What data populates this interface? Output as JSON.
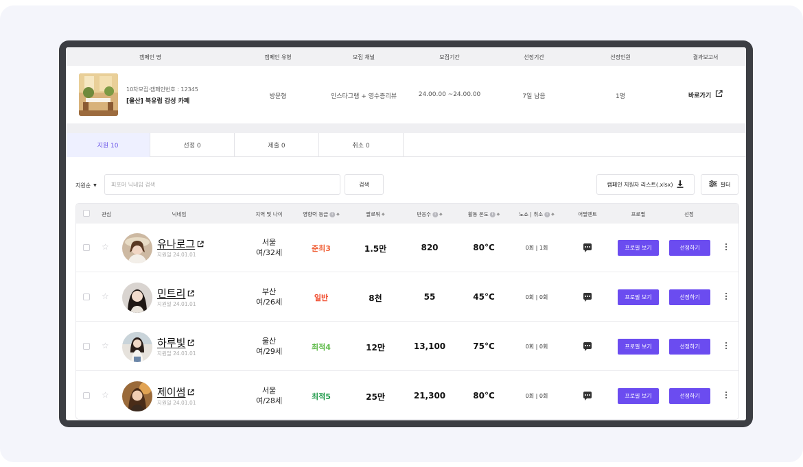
{
  "campaign": {
    "headers": [
      "캠페인 명",
      "캠페인 유형",
      "모집 채널",
      "모집기간",
      "선정기간",
      "선정인원",
      "결과보고서"
    ],
    "subtitle": "10차모집·캠페인번호 : 12345",
    "title": "[울산] 북유럽 감성 카페",
    "type": "방문형",
    "channel": "인스타그램 + 영수증리뷰",
    "recruit_period": "24.00.00 ~24.00.00",
    "select_period": "7일 남음",
    "select_count": "1명",
    "report_link": "바로가기"
  },
  "tabs": [
    {
      "label": "지원 10",
      "active": true
    },
    {
      "label": "선정 0",
      "active": false
    },
    {
      "label": "제출 0",
      "active": false
    },
    {
      "label": "취소 0",
      "active": false
    }
  ],
  "toolbar": {
    "sort_label": "지원순",
    "search_placeholder": "피포머 닉네임 검색",
    "search_button": "검색",
    "excel_button": "캠페인 지원자 리스트(.xlsx)",
    "filter_button": "필터"
  },
  "table": {
    "headers": {
      "fav": "관심",
      "nickname": "닉네임",
      "region_age": "지역 및 나이",
      "grade": "영향력 등급",
      "followers": "팔로워",
      "responses": "반응수",
      "temperature": "활동 온도",
      "exposure": "노쇼 | 취소",
      "comment": "어필멘트",
      "profile": "프로필",
      "select": "선정"
    },
    "profile_button": "프로필 보기",
    "select_button": "선정하기",
    "rows": [
      {
        "nickname": "유나로그",
        "applied": "지원일 24.01.01",
        "region": "서울",
        "age": "여/32세",
        "grade": "준최3",
        "grade_color": "#f0643c",
        "followers": "1.5만",
        "responses": "820",
        "temperature": "80°C",
        "noshow": "0회 | 1회"
      },
      {
        "nickname": "민트리",
        "applied": "지원일 24.01.01",
        "region": "부산",
        "age": "여/26세",
        "grade": "일반",
        "grade_color": "#f04b2d",
        "followers": "8천",
        "responses": "55",
        "temperature": "45°C",
        "noshow": "0회 | 0회"
      },
      {
        "nickname": "하루빛",
        "applied": "지원일 24.01.01",
        "region": "울산",
        "age": "여/29세",
        "grade": "최적4",
        "grade_color": "#5fbb4a",
        "followers": "12만",
        "responses": "13,100",
        "temperature": "75°C",
        "noshow": "0회 | 0회"
      },
      {
        "nickname": "제이썸",
        "applied": "지원일 24.01.01",
        "region": "서울",
        "age": "여/28세",
        "grade": "최적5",
        "grade_color": "#1f9a4a",
        "followers": "25만",
        "responses": "21,300",
        "temperature": "80°C",
        "noshow": "0회 | 0회"
      }
    ]
  },
  "icons": [
    "external-link-icon",
    "download-icon",
    "filter-icon",
    "star-icon",
    "info-icon",
    "sort-icon",
    "comment-icon",
    "more-icon",
    "caret-down-icon"
  ],
  "colors": {
    "accent": "#6b4cf0",
    "tab_active_bg": "#eef0ff",
    "tab_active_text": "#6a55e8"
  }
}
